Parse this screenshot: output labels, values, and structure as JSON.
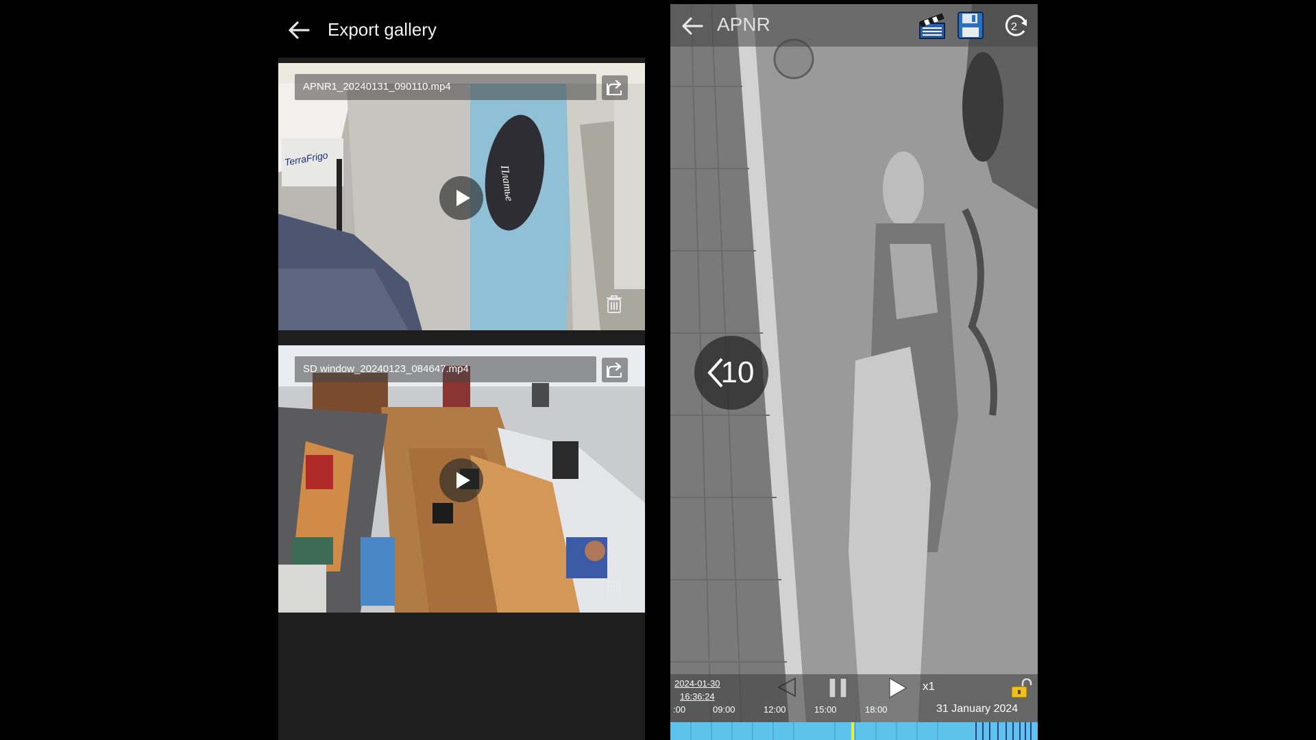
{
  "gallery": {
    "title": "Export gallery",
    "items": [
      {
        "filename": "APNR1_20240131_090110.mp4"
      },
      {
        "filename": "SD window_20240123_084647.mp4"
      }
    ]
  },
  "player": {
    "title": "APNR",
    "rewind_label": "<10",
    "timestamp_date": "2024-01-30",
    "timestamp_time": "16:36:24",
    "speed": "x1",
    "timeline": {
      "ticks": [
        ":00",
        "09:00",
        "12:00",
        "15:00",
        "18:00"
      ],
      "date": "31 January 2024"
    }
  },
  "colors": {
    "timeline": "#5ec3ec",
    "cursor": "#e6f03c",
    "lock": "#f0c020"
  },
  "icons": [
    "back-arrow-icon",
    "share-icon",
    "play-icon",
    "trash-icon",
    "clapperboard-icon",
    "save-icon",
    "sync-icon",
    "pause-icon",
    "lock-icon"
  ]
}
